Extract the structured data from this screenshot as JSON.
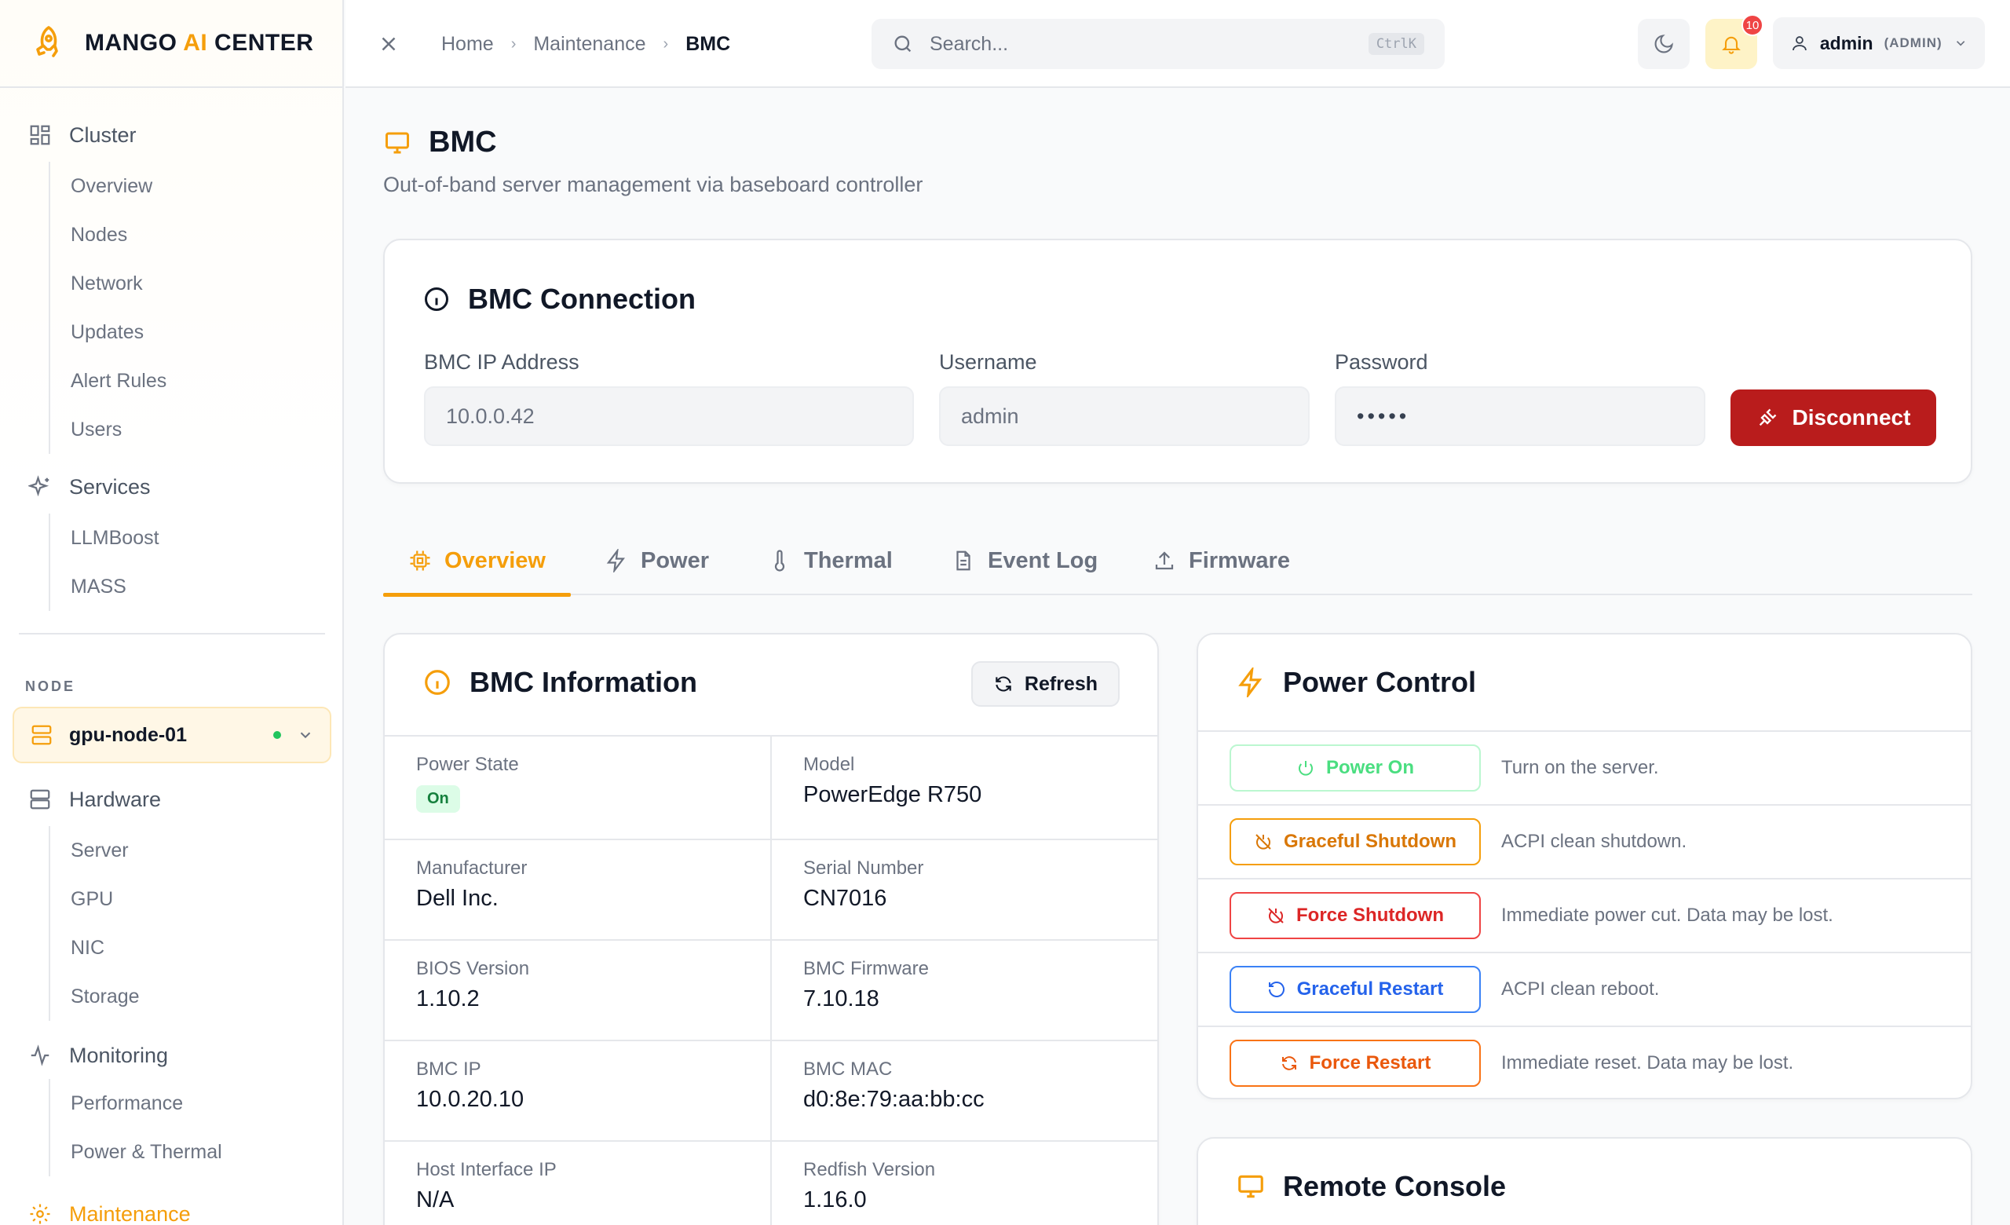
{
  "brand": {
    "name_left": "MANGO ",
    "name_ai": "AI",
    "name_right": " CENTER"
  },
  "sidebar": {
    "cluster": {
      "label": "Cluster",
      "items": [
        "Overview",
        "Nodes",
        "Network",
        "Updates",
        "Alert Rules",
        "Users"
      ]
    },
    "services": {
      "label": "Services",
      "items": [
        "LLMBoost",
        "MASS"
      ]
    },
    "node_section_label": "NODE",
    "node_select": {
      "value": "gpu-node-01",
      "status_color": "#22c55e"
    },
    "hardware": {
      "label": "Hardware",
      "items": [
        "Server",
        "GPU",
        "NIC",
        "Storage"
      ]
    },
    "monitoring": {
      "label": "Monitoring",
      "items": [
        "Performance",
        "Power & Thermal"
      ]
    },
    "maintenance": {
      "label": "Maintenance"
    }
  },
  "topbar": {
    "breadcrumb": [
      "Home",
      "Maintenance",
      "BMC"
    ],
    "search": {
      "placeholder": "Search...",
      "shortcut": "CtrlK"
    },
    "notifications_count": "10",
    "user": {
      "name": "admin",
      "role": "(ADMIN)"
    }
  },
  "page": {
    "title": "BMC",
    "subtitle": "Out-of-band server management via baseboard controller"
  },
  "connection": {
    "title": "BMC Connection",
    "ip_label": "BMC IP Address",
    "ip_value": "10.0.0.42",
    "user_label": "Username",
    "user_value": "admin",
    "pass_label": "Password",
    "pass_value": "•••••",
    "disconnect_label": "Disconnect"
  },
  "tabs": [
    "Overview",
    "Power",
    "Thermal",
    "Event Log",
    "Firmware"
  ],
  "bmc_info": {
    "title": "BMC Information",
    "refresh_label": "Refresh",
    "rows": [
      [
        {
          "label": "Power State",
          "value": "On",
          "pill": true
        },
        {
          "label": "Model",
          "value": "PowerEdge R750"
        }
      ],
      [
        {
          "label": "Manufacturer",
          "value": "Dell Inc."
        },
        {
          "label": "Serial Number",
          "value": "CN7016"
        }
      ],
      [
        {
          "label": "BIOS Version",
          "value": "1.10.2"
        },
        {
          "label": "BMC Firmware",
          "value": "7.10.18"
        }
      ],
      [
        {
          "label": "BMC IP",
          "value": "10.0.20.10"
        },
        {
          "label": "BMC MAC",
          "value": "d0:8e:79:aa:bb:cc"
        }
      ],
      [
        {
          "label": "Host Interface IP",
          "value": "N/A"
        },
        {
          "label": "Redfish Version",
          "value": "1.16.0"
        }
      ]
    ]
  },
  "power_control": {
    "title": "Power Control",
    "actions": [
      {
        "label": "Power On",
        "desc": "Turn on the server.",
        "color": "#86efac",
        "text": "#4ade80"
      },
      {
        "label": "Graceful Shutdown",
        "desc": "ACPI clean shutdown.",
        "color": "#f59e0b",
        "text": "#d97706"
      },
      {
        "label": "Force Shutdown",
        "desc": "Immediate power cut. Data may be lost.",
        "color": "#ef4444",
        "text": "#dc2626"
      },
      {
        "label": "Graceful Restart",
        "desc": "ACPI clean reboot.",
        "color": "#3b82f6",
        "text": "#2563eb"
      },
      {
        "label": "Force Restart",
        "desc": "Immediate reset. Data may be lost.",
        "color": "#f97316",
        "text": "#ea580c"
      }
    ]
  },
  "remote_console": {
    "title": "Remote Console"
  },
  "colors": {
    "accent": "#f59e0b",
    "danger": "#b91c1c"
  }
}
